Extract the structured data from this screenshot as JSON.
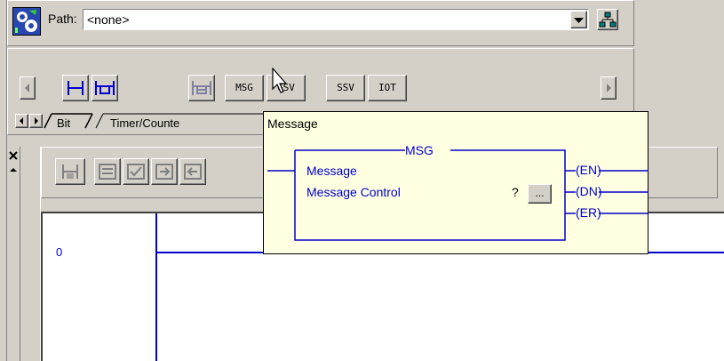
{
  "path_bar": {
    "label": "Path:",
    "value": "<none>"
  },
  "instruction_toolbar": {
    "buttons": [
      "MSG",
      "GSV",
      "SSV",
      "IOT"
    ]
  },
  "category_tabs": [
    "Bit",
    "Timer/Counte"
  ],
  "tooltip": {
    "title": "Message",
    "block_name": "MSG",
    "row1_label": "Message",
    "row2_label": "Message Control",
    "row2_value": "?",
    "browse_button": "...",
    "outputs": [
      "EN",
      "DN",
      "ER"
    ]
  },
  "ladder": {
    "rung_number": "0"
  },
  "colors": {
    "accent": "#0000cc",
    "tooltip_bg": "#ffffe1",
    "window_bg": "#d4d0c8"
  }
}
